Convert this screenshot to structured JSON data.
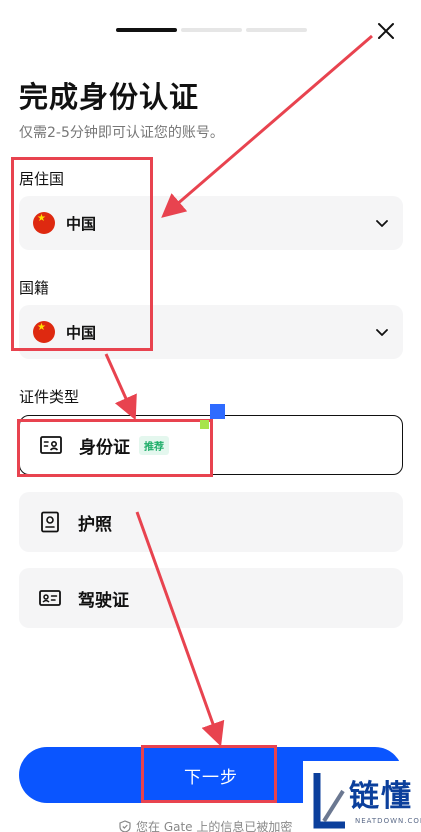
{
  "progress": {
    "total_steps": 3,
    "current_step": 1
  },
  "close": {
    "icon": "close-icon"
  },
  "header": {
    "title": "完成身份认证",
    "subtitle": "仅需2-5分钟即可认证您的账号。"
  },
  "residence": {
    "label": "居住国",
    "value": "中国",
    "flag": "china-flag-icon"
  },
  "nationality": {
    "label": "国籍",
    "value": "中国",
    "flag": "china-flag-icon"
  },
  "id_type": {
    "label": "证件类型",
    "options": [
      {
        "label": "身份证",
        "badge": "推荐",
        "icon": "id-card-icon",
        "selected": true
      },
      {
        "label": "护照",
        "icon": "passport-icon",
        "selected": false
      },
      {
        "label": "驾驶证",
        "icon": "driver-license-icon",
        "selected": false
      }
    ]
  },
  "next_button": {
    "label": "下一步"
  },
  "footer": {
    "text": "您在 Gate 上的信息已被加密"
  },
  "watermark": {
    "cn": "链懂",
    "en": "NEATDOWN.COM"
  },
  "colors": {
    "primary": "#0a55ff",
    "annotation": "#e8434f",
    "badge_text": "#1fae6a",
    "field_bg": "#f5f5f6"
  }
}
